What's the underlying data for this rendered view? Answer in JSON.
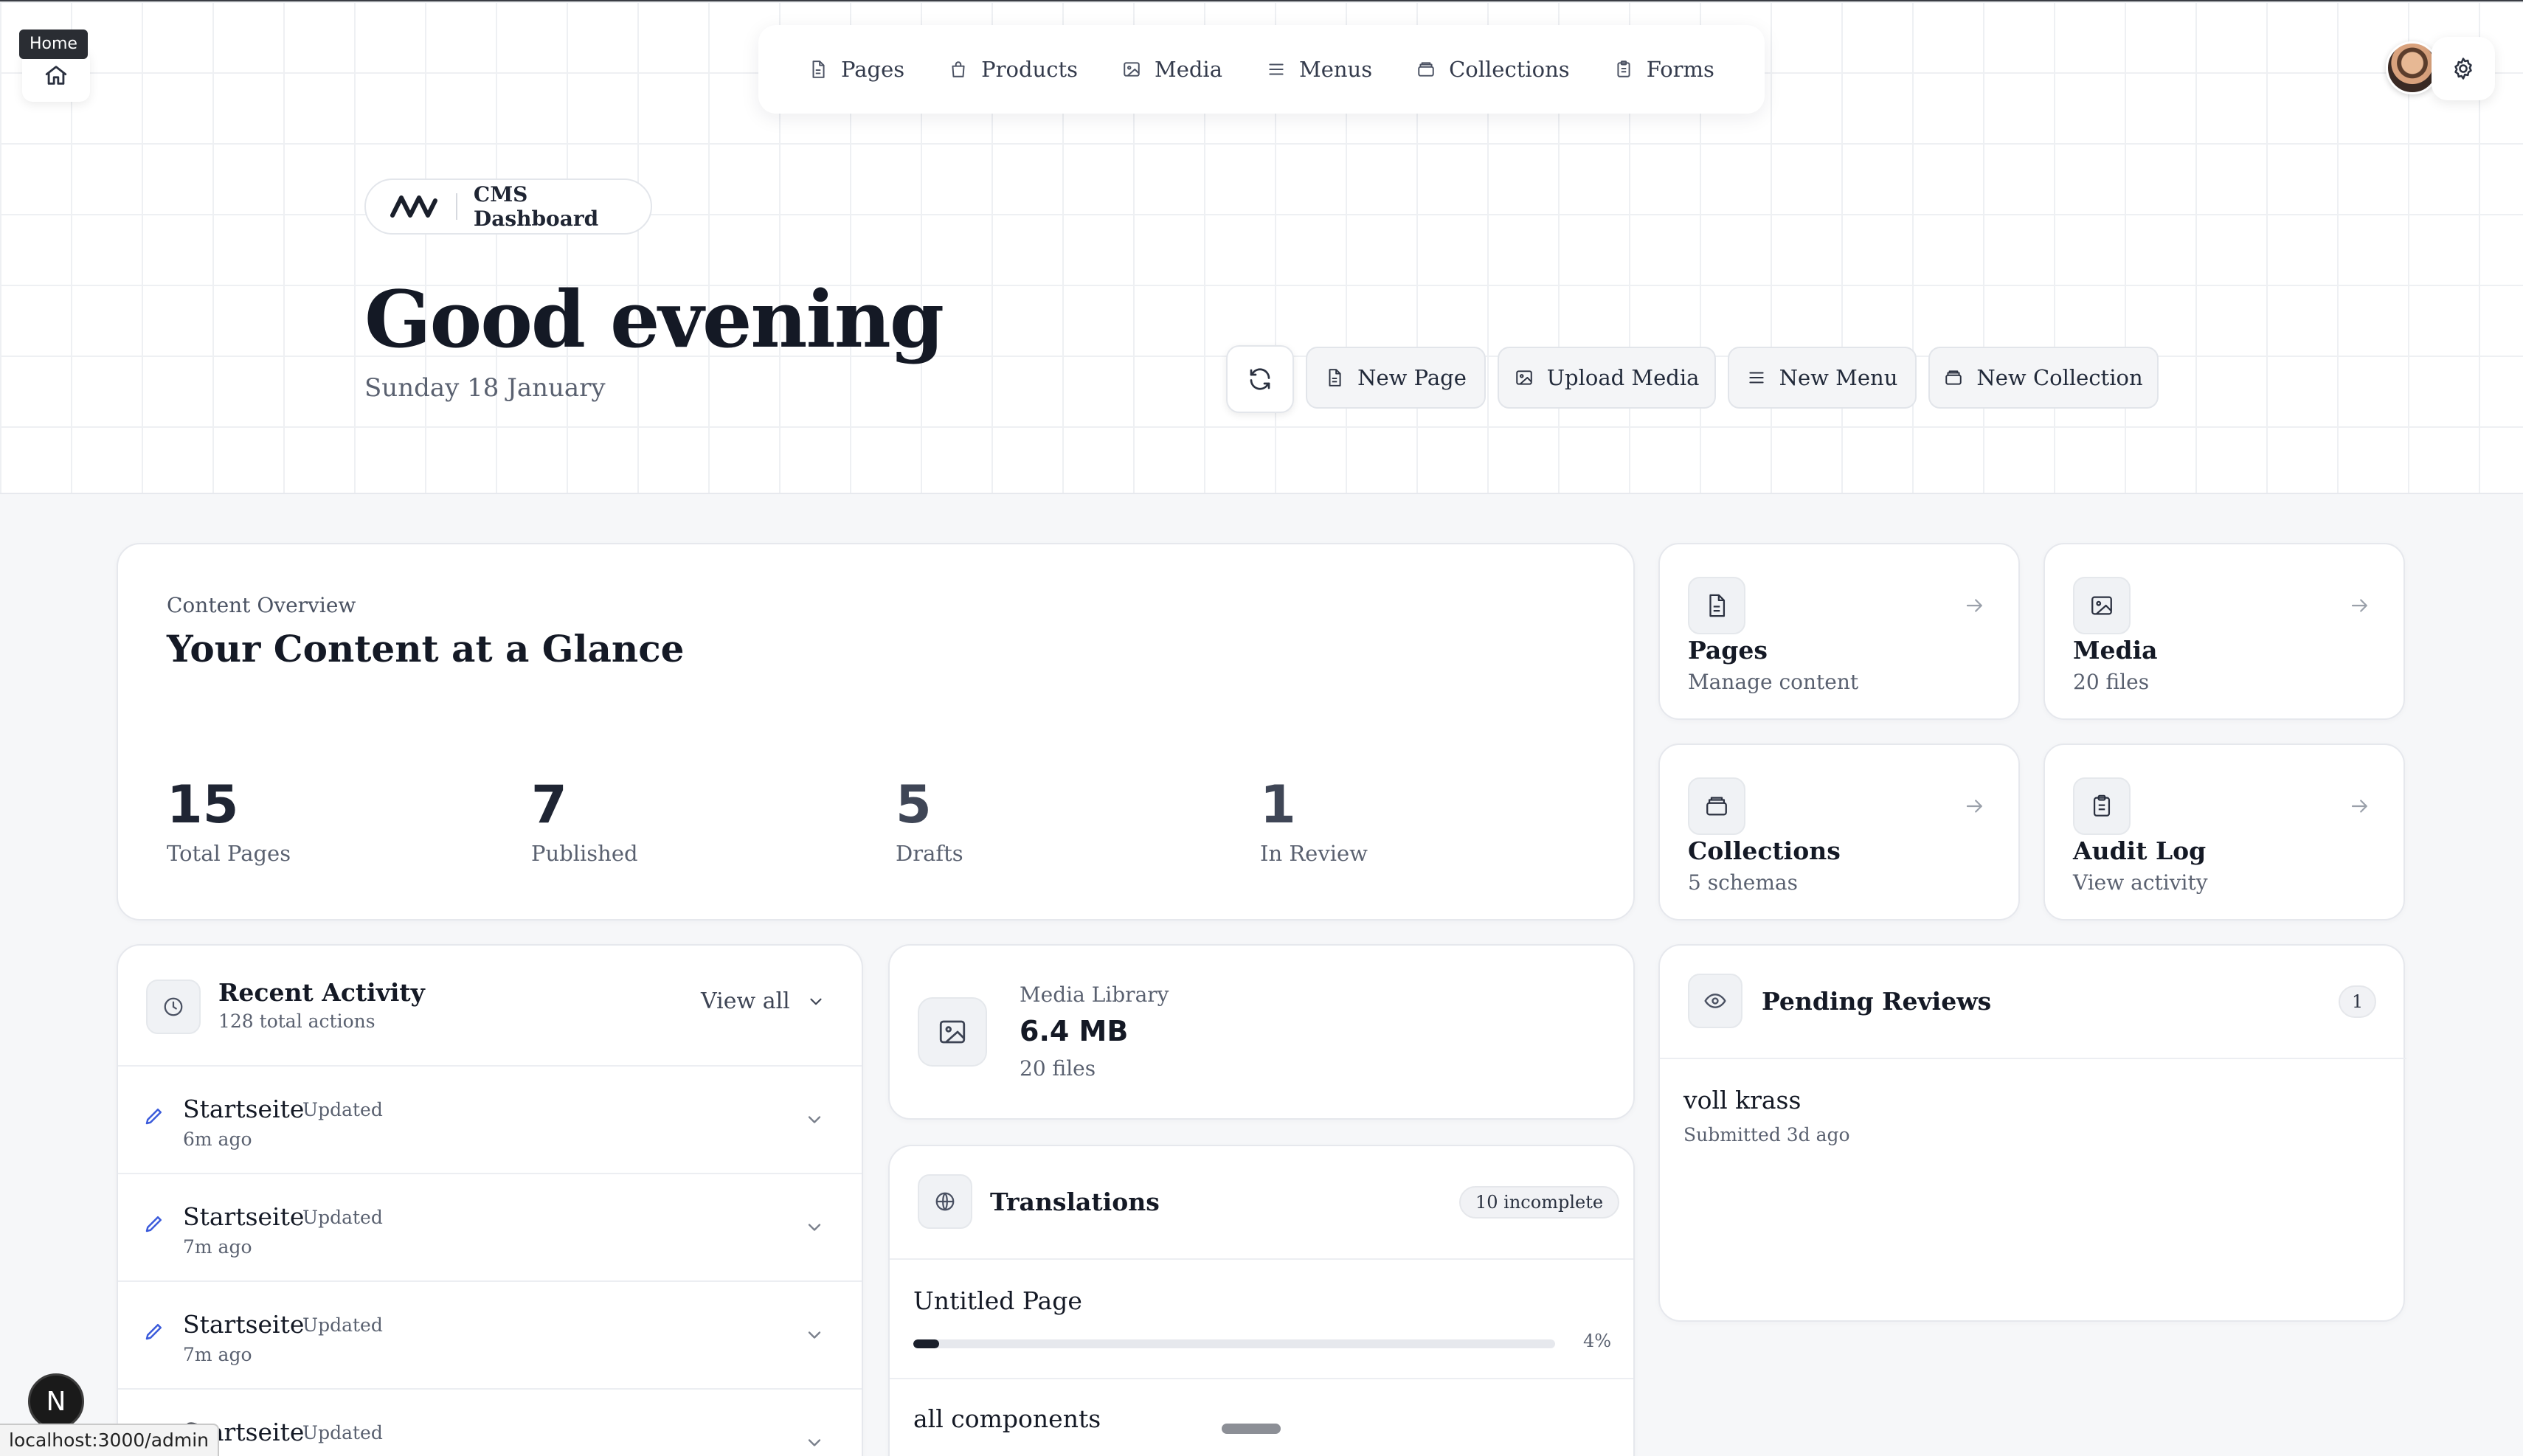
{
  "browser": {
    "home_tooltip": "Home",
    "status_url": "localhost:3000/admin",
    "dev_badge": "N"
  },
  "nav": {
    "items": [
      {
        "label": "Pages",
        "icon": "file-icon"
      },
      {
        "label": "Products",
        "icon": "bag-icon"
      },
      {
        "label": "Media",
        "icon": "image-icon"
      },
      {
        "label": "Menus",
        "icon": "menu-icon"
      },
      {
        "label": "Collections",
        "icon": "box-icon"
      },
      {
        "label": "Forms",
        "icon": "clipboard-icon"
      }
    ]
  },
  "header": {
    "brand_label": "CMS Dashboard",
    "greeting": "Good evening",
    "date": "Sunday 18 January",
    "actions": {
      "new_page": "New Page",
      "upload_media": "Upload Media",
      "new_menu": "New Menu",
      "new_collection": "New Collection"
    }
  },
  "overview": {
    "eyebrow": "Content Overview",
    "title": "Your Content at a Glance",
    "stats": [
      {
        "value": "15",
        "label": "Total Pages"
      },
      {
        "value": "7",
        "label": "Published"
      },
      {
        "value": "5",
        "label": "Drafts"
      },
      {
        "value": "1",
        "label": "In Review"
      }
    ]
  },
  "tiles": [
    {
      "title": "Pages",
      "subtitle": "Manage content",
      "icon": "file-icon"
    },
    {
      "title": "Media",
      "subtitle": "20 files",
      "icon": "image-icon"
    },
    {
      "title": "Collections",
      "subtitle": "5 schemas",
      "icon": "box-icon"
    },
    {
      "title": "Audit Log",
      "subtitle": "View activity",
      "icon": "clipboard-icon"
    }
  ],
  "activity": {
    "title": "Recent Activity",
    "subtitle": "128 total actions",
    "view_all": "View all",
    "rows": [
      {
        "name": "Startseite",
        "action": "Updated",
        "time": "6m ago"
      },
      {
        "name": "Startseite",
        "action": "Updated",
        "time": "7m ago"
      },
      {
        "name": "Startseite",
        "action": "Updated",
        "time": "7m ago"
      },
      {
        "name": "Startseite",
        "action": "Updated",
        "time": ""
      }
    ]
  },
  "media_library": {
    "label": "Media Library",
    "size": "6.4 MB",
    "count": "20 files"
  },
  "translations": {
    "title": "Translations",
    "badge": "10 incomplete",
    "items": [
      {
        "name": "Untitled Page",
        "percent": 4,
        "percent_label": "4%"
      },
      {
        "name": "all components",
        "percent": 0,
        "percent_label": ""
      }
    ]
  },
  "reviews": {
    "title": "Pending Reviews",
    "count": "1",
    "items": [
      {
        "name": "voll krass",
        "meta": "Submitted 3d ago"
      }
    ]
  },
  "colors": {
    "accent_pencil": "#3b5bdb",
    "ink": "#141925",
    "muted": "#5a6170"
  }
}
